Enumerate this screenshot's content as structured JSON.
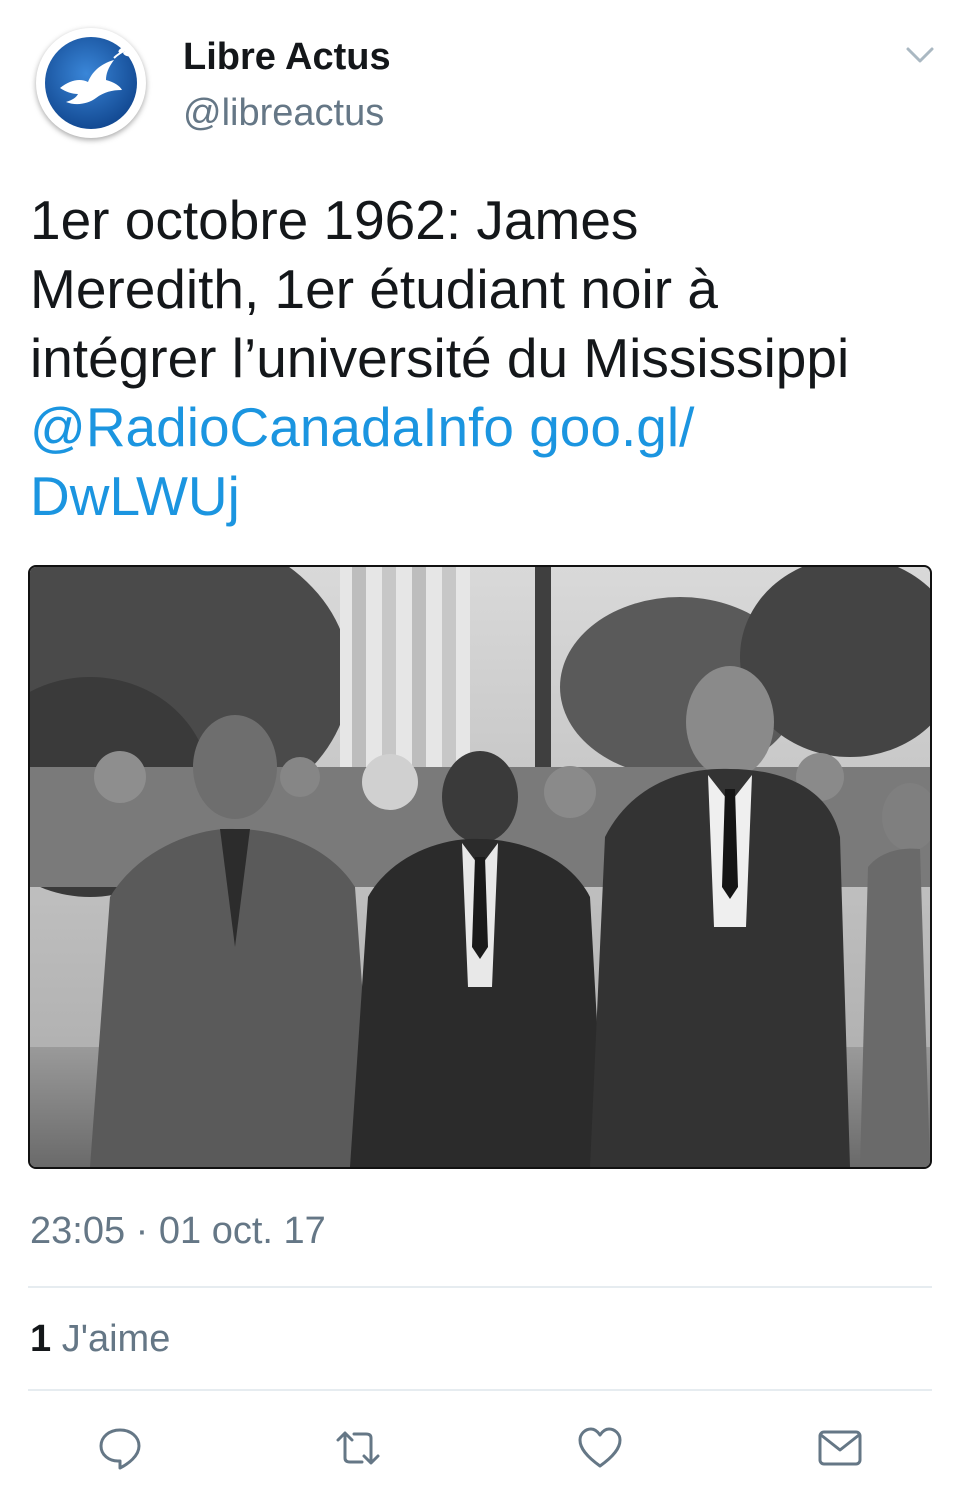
{
  "tweet": {
    "author": {
      "name": "Libre Actus",
      "handle": "@libreactus",
      "avatar_icon": "white-dove-icon",
      "avatar_color": "#1e5fb4"
    },
    "text": {
      "line1": "1er octobre 1962: James",
      "line2": "Meredith, 1er étudiant noir à",
      "line3": "intégrer l’université du Mississippi",
      "mention": "@RadioCanadaInfo",
      "url_part1": "goo.gl/",
      "url_part2": "DwLWUj"
    },
    "media": {
      "type": "black-and-white photo",
      "alt": "James Meredith walking with officials at the University of Mississippi"
    },
    "timestamp": "23:05 · 01 oct. 17",
    "likes": {
      "count": "1",
      "label": "J'aime"
    },
    "actions": [
      {
        "name": "reply",
        "icon": "reply-icon"
      },
      {
        "name": "retweet",
        "icon": "retweet-icon"
      },
      {
        "name": "like",
        "icon": "heart-icon"
      },
      {
        "name": "message",
        "icon": "envelope-icon"
      }
    ]
  },
  "colors": {
    "link": "#1b95e0",
    "secondary_text": "#657786",
    "primary_text": "#14171a",
    "divider": "#e6ecf0"
  }
}
